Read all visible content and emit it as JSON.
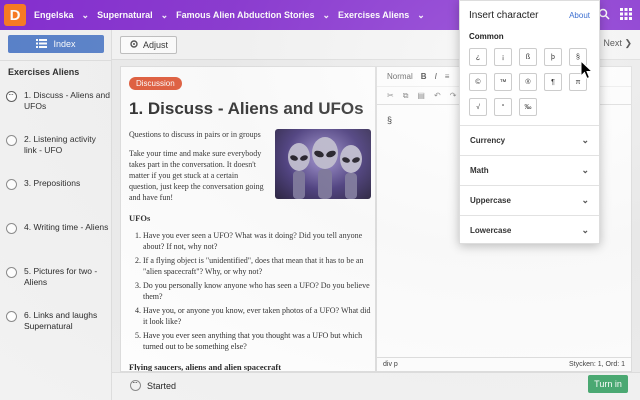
{
  "topbar": {
    "logo": "D",
    "crumbs": [
      "Engelska",
      "Supernatural",
      "Famous Alien Abduction Stories",
      "Exercises Aliens"
    ],
    "chevron": "⌄",
    "icons": [
      "search-icon",
      "grid-icon"
    ]
  },
  "sidebar": {
    "index_label": "Index",
    "title": "Exercises Aliens",
    "steps": [
      {
        "label": "1. Discuss - Aliens and UFOs",
        "state": "active"
      },
      {
        "label": "2. Listening activity link - UFO",
        "state": "todo"
      },
      {
        "label": "3. Prepositions",
        "state": "todo"
      },
      {
        "label": "4. Writing time - Aliens",
        "state": "todo"
      },
      {
        "label": "5. Pictures for two - Aliens",
        "state": "todo"
      },
      {
        "label": "6. Links and laughs Supernatural",
        "state": "todo"
      }
    ]
  },
  "toolbar": {
    "adjust_label": "Adjust",
    "next_label": "Next",
    "next_icon": "❯"
  },
  "content": {
    "badge": "Discussion",
    "title": "1. Discuss - Aliens and UFOs",
    "intro": "Questions to discuss in pairs or in groups",
    "intro2": "Take your time and make sure everybody takes part in the conversation. It doesn't matter if you get stuck at a certain question, just keep the conversation going and have fun!",
    "section1": "UFOs",
    "questions": [
      "Have you ever seen a UFO? What was it doing? Did you tell anyone about? If not, why not?",
      "If a flying object is \"unidentified\", does that mean that it has to be an \"alien spacecraft\"? Why, or why not?",
      "Do you personally know anyone who has seen a UFO? Do you believe them?",
      "Have you, or anyone you know, ever taken photos of a UFO? What did it look like?",
      "Have you ever seen anything that you thought was a UFO but which turned out to be something else?"
    ],
    "section2": "Flying saucers, aliens and alien spacecraft"
  },
  "editor": {
    "style_select": "Normal",
    "bold": "B",
    "italic": "I",
    "list_icon": "≡",
    "content_char": "§",
    "status_left": "div  p",
    "status_right": "Stycken: 1, Ord: 1"
  },
  "bottom": {
    "started_label": "Started",
    "turnin_label": "Turn in"
  },
  "popup": {
    "title": "Insert character",
    "about": "About",
    "common_label": "Common",
    "chars": [
      "¿",
      "¡",
      "ß",
      "þ",
      "§",
      "©",
      "™",
      "®",
      "¶",
      "π",
      "√",
      "°",
      "‰"
    ],
    "categories": [
      "Currency",
      "Math",
      "Uppercase",
      "Lowercase"
    ],
    "chevron": "⌄"
  },
  "colors": {
    "topbar": "#7e22ce",
    "logo": "#f97316",
    "index_button": "#4f7ac7",
    "badge": "#e0522f",
    "turnin": "#3fa56a",
    "link": "#3c6fd1"
  }
}
